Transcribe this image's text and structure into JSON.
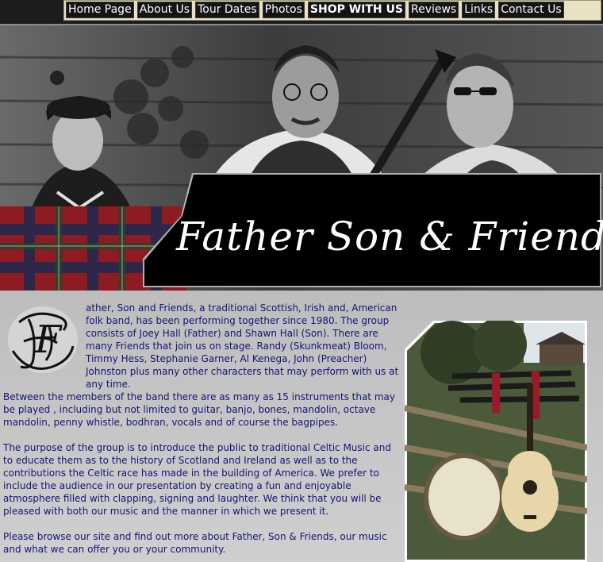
{
  "nav": {
    "items": [
      {
        "label": "Home Page"
      },
      {
        "label": "About Us"
      },
      {
        "label": "Tour Dates"
      },
      {
        "label": "Photos"
      },
      {
        "label": "SHOP WITH US"
      },
      {
        "label": "Reviews"
      },
      {
        "label": "Links"
      },
      {
        "label": "Contact Us"
      }
    ]
  },
  "hero": {
    "title": "Father Son & Friends"
  },
  "body": {
    "p1": "ather, Son and Friends, a traditional Scottish, Irish and, American folk band, has been performing together since 1980. The group consists of Joey Hall (Father) and Shawn Hall (Son). There are many Friends that join us on stage. Randy (Skunkmeat) Bloom, Timmy Hess, Stephanie Garner, Al Kenega, John (Preacher) Johnston plus many other characters that may perform with us at any time.",
    "p2": "Between the members of the band there are as many as 15 instruments that may be played , including but not limited to guitar, banjo, bones, mandolin, octave mandolin, penny whistle, bodhran, vocals and of course the bagpipes.",
    "p3": "The purpose of the group is to introduce the public to traditional Celtic Music and to educate them as to the history of Scotland and Ireland as well as to the contributions the Celtic race has made in the building of America. We prefer to include the audience in our presentation by creating a fun and enjoyable atmosphere filled with clapping, signing and laughter. We think that you will be pleased with both our music and the manner in which we present it.",
    "p4": "Please browse our site and find out more about Father, Son & Friends, our music and what we can offer you or your community."
  },
  "colors": {
    "text": "#141477",
    "nav_bg": "#141414",
    "nav_frame": "#e9e2c2",
    "title_box": "#000000",
    "tartan_red": "#8e1a22"
  }
}
